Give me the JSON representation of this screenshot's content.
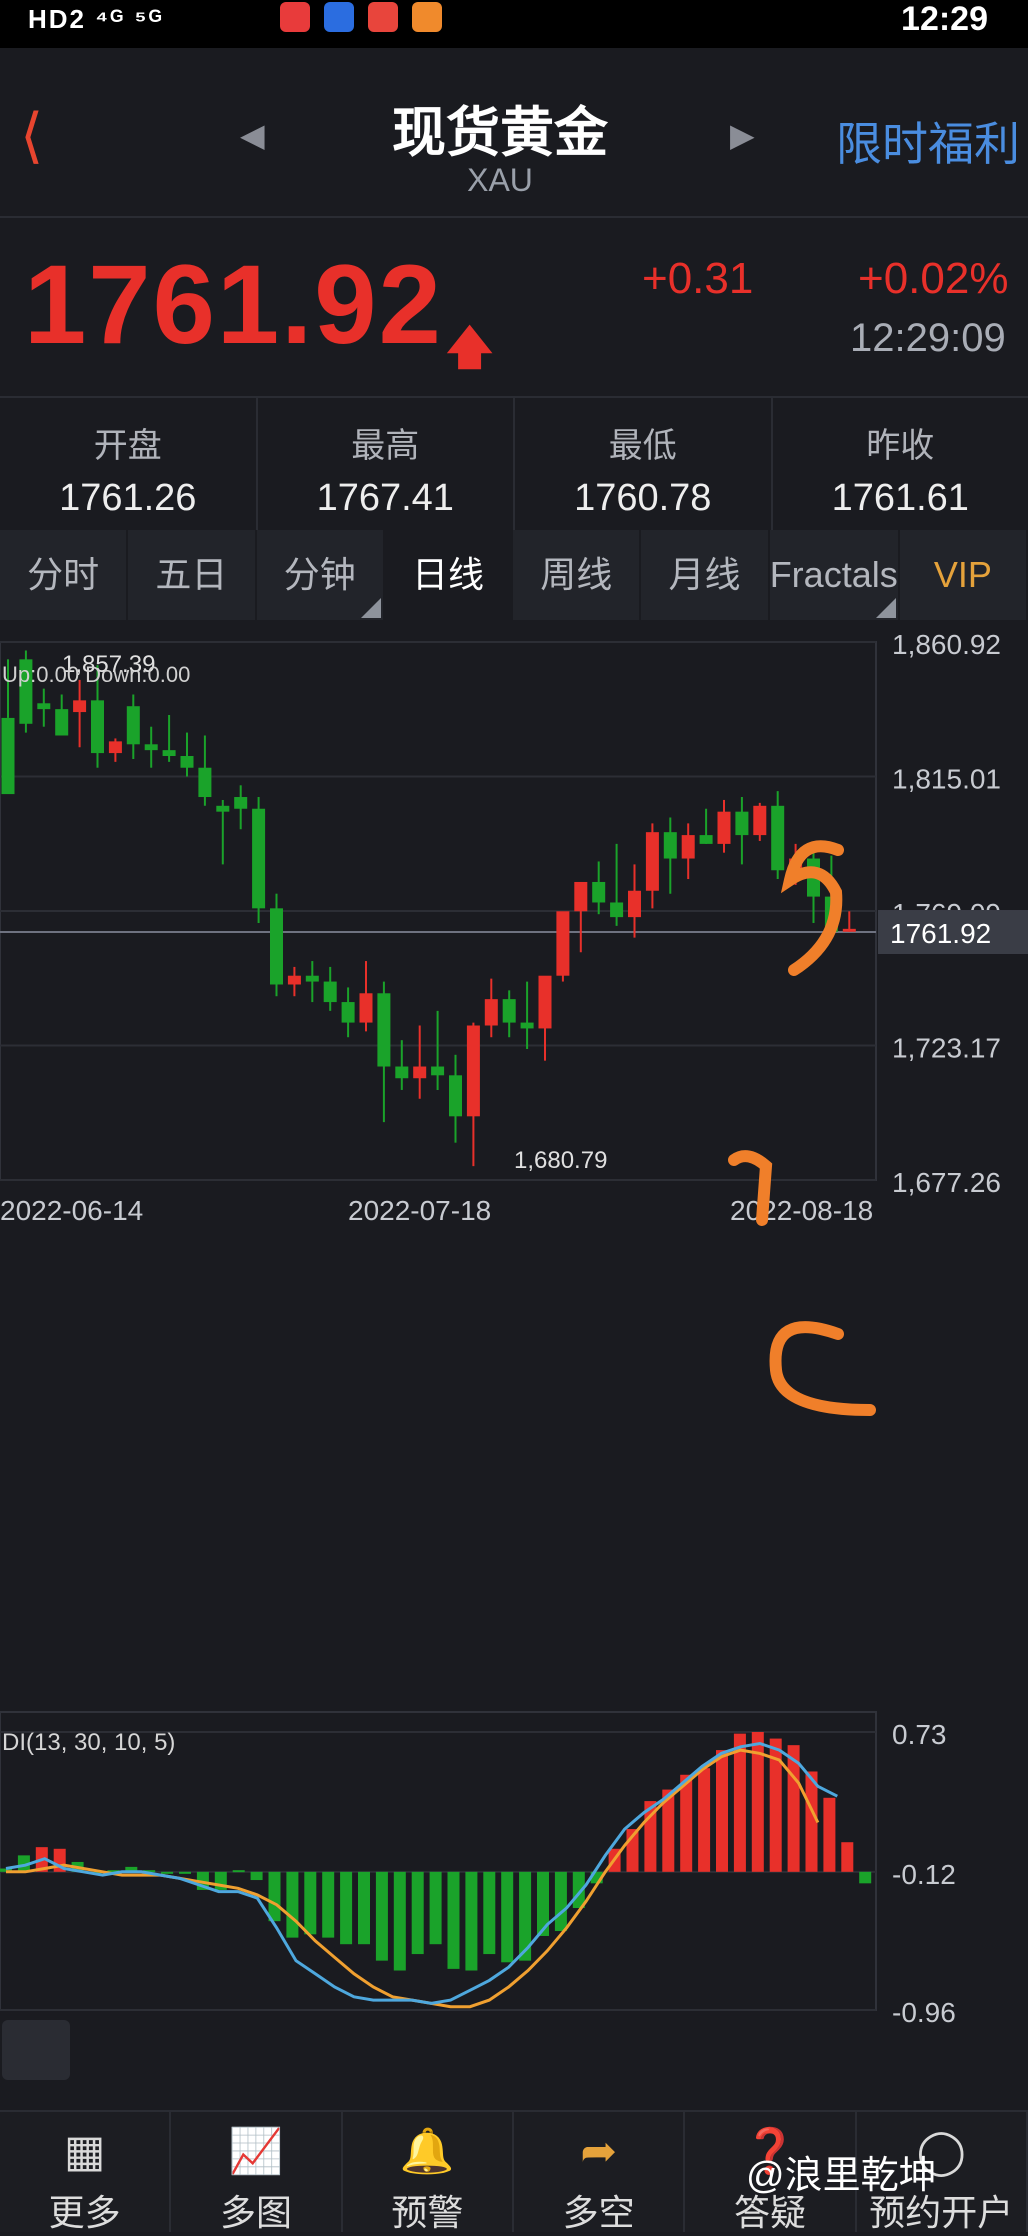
{
  "status_bar": {
    "left": "HD2 ⁴ᴳ ⁵ᴳ",
    "time": "12:29",
    "app_colors": [
      "#e83b3b",
      "#2b6de0",
      "#e8453c",
      "#f08a2c"
    ]
  },
  "header": {
    "title": "现货黄金",
    "subtitle": "XAU",
    "promo": "限时福利"
  },
  "quote": {
    "price": "1761.92",
    "change": "+0.31",
    "percent": "+0.02%",
    "time": "12:29:09"
  },
  "stats": [
    {
      "label": "开盘",
      "value": "1761.26"
    },
    {
      "label": "最高",
      "value": "1767.41"
    },
    {
      "label": "最低",
      "value": "1760.78"
    },
    {
      "label": "昨收",
      "value": "1761.61"
    }
  ],
  "tabs": [
    {
      "label": "分时",
      "corner": false
    },
    {
      "label": "五日",
      "corner": false
    },
    {
      "label": "分钟",
      "corner": true
    },
    {
      "label": "日线",
      "corner": false
    },
    {
      "label": "周线",
      "corner": false
    },
    {
      "label": "月线",
      "corner": false
    },
    {
      "label": "Fractals",
      "corner": true
    },
    {
      "label": "VIP",
      "corner": false
    }
  ],
  "chart_data": {
    "type": "candlestick",
    "y_axis": [
      "1,860.92",
      "1,815.01",
      "1,769.09",
      "1,723.17",
      "1,677.26"
    ],
    "ylim": [
      1677.26,
      1860.92
    ],
    "current_price": "1761.92",
    "x_axis": [
      "2022-06-14",
      "2022-07-18",
      "2022-08-18"
    ],
    "high_label": "1,857.39",
    "low_label": "1,680.79",
    "legend": "Up:0.00  Down:0.00",
    "colors": {
      "up": "#e8302a",
      "down": "#1aa32a"
    },
    "candles": [
      [
        1835,
        1855,
        1835,
        1809
      ],
      [
        1855,
        1858,
        1830,
        1833
      ],
      [
        1840,
        1845,
        1832,
        1838
      ],
      [
        1838,
        1843,
        1830,
        1829
      ],
      [
        1837,
        1848,
        1825,
        1841
      ],
      [
        1841,
        1853,
        1818,
        1823
      ],
      [
        1823,
        1828,
        1820,
        1827
      ],
      [
        1839,
        1843,
        1821,
        1826
      ],
      [
        1826,
        1832,
        1818,
        1824
      ],
      [
        1824,
        1836,
        1820,
        1822
      ],
      [
        1822,
        1830,
        1815,
        1818
      ],
      [
        1818,
        1829,
        1805,
        1808
      ],
      [
        1805,
        1807,
        1785,
        1803
      ],
      [
        1808,
        1812,
        1797,
        1804
      ],
      [
        1804,
        1808,
        1765,
        1770
      ],
      [
        1770,
        1775,
        1740,
        1744
      ],
      [
        1744,
        1750,
        1740,
        1747
      ],
      [
        1747,
        1752,
        1738,
        1745
      ],
      [
        1745,
        1750,
        1735,
        1738
      ],
      [
        1738,
        1743,
        1726,
        1731
      ],
      [
        1731,
        1752,
        1728,
        1741
      ],
      [
        1741,
        1745,
        1697,
        1716
      ],
      [
        1716,
        1725,
        1708,
        1712
      ],
      [
        1712,
        1730,
        1705,
        1716
      ],
      [
        1716,
        1735,
        1708,
        1713
      ],
      [
        1713,
        1720,
        1690,
        1699
      ],
      [
        1699,
        1731,
        1682,
        1730
      ],
      [
        1730,
        1746,
        1726,
        1739
      ],
      [
        1739,
        1742,
        1726,
        1731
      ],
      [
        1731,
        1745,
        1722,
        1729
      ],
      [
        1729,
        1743,
        1718,
        1747
      ],
      [
        1747,
        1766,
        1745,
        1769
      ],
      [
        1769,
        1779,
        1755,
        1779
      ],
      [
        1779,
        1786,
        1768,
        1772
      ],
      [
        1772,
        1792,
        1764,
        1767
      ],
      [
        1767,
        1785,
        1760,
        1776
      ],
      [
        1776,
        1799,
        1770,
        1796
      ],
      [
        1796,
        1801,
        1775,
        1787
      ],
      [
        1787,
        1799,
        1780,
        1795
      ],
      [
        1795,
        1804,
        1792,
        1792
      ],
      [
        1792,
        1807,
        1789,
        1803
      ],
      [
        1803,
        1808,
        1785,
        1795
      ],
      [
        1795,
        1806,
        1793,
        1805
      ],
      [
        1805,
        1810,
        1780,
        1783
      ],
      [
        1783,
        1792,
        1778,
        1787
      ],
      [
        1787,
        1789,
        1765,
        1774
      ],
      [
        1774,
        1788,
        1762,
        1762
      ],
      [
        1762,
        1769,
        1762,
        1763
      ]
    ],
    "indicator": {
      "label": "DI(13, 30, 10, 5)",
      "y_axis": [
        "0.73",
        "-0.12",
        "-0.96"
      ],
      "ylim": [
        -0.96,
        0.73
      ],
      "histogram": [
        -0.1,
        -0.02,
        0.03,
        0.02,
        -0.06,
        -0.12,
        -0.11,
        -0.09,
        -0.11,
        -0.13,
        -0.13,
        -0.23,
        -0.23,
        -0.11,
        -0.17,
        -0.42,
        -0.52,
        -0.5,
        -0.52,
        -0.56,
        -0.56,
        -0.66,
        -0.72,
        -0.62,
        -0.56,
        -0.71,
        -0.72,
        -0.62,
        -0.67,
        -0.66,
        -0.51,
        -0.48,
        -0.34,
        -0.19,
        0.02,
        0.14,
        0.31,
        0.38,
        0.47,
        0.51,
        0.62,
        0.72,
        0.73,
        0.69,
        0.65,
        0.49,
        0.33,
        0.06,
        -0.19
      ],
      "line_fast": [
        -0.1,
        -0.08,
        -0.04,
        -0.1,
        -0.12,
        -0.14,
        -0.12,
        -0.12,
        -0.14,
        -0.16,
        -0.2,
        -0.24,
        -0.24,
        -0.28,
        -0.46,
        -0.66,
        -0.74,
        -0.82,
        -0.88,
        -0.9,
        -0.9,
        -0.9,
        -0.92,
        -0.9,
        -0.84,
        -0.78,
        -0.7,
        -0.58,
        -0.44,
        -0.34,
        -0.2,
        -0.02,
        0.14,
        0.24,
        0.32,
        0.42,
        0.52,
        0.6,
        0.64,
        0.66,
        0.62,
        0.54,
        0.4,
        0.34
      ],
      "line_slow": [
        -0.12,
        -0.12,
        -0.1,
        -0.08,
        -0.1,
        -0.12,
        -0.14,
        -0.14,
        -0.14,
        -0.16,
        -0.18,
        -0.2,
        -0.22,
        -0.26,
        -0.32,
        -0.42,
        -0.54,
        -0.64,
        -0.74,
        -0.82,
        -0.88,
        -0.9,
        -0.92,
        -0.94,
        -0.94,
        -0.9,
        -0.82,
        -0.72,
        -0.6,
        -0.46,
        -0.3,
        -0.12,
        0.04,
        0.18,
        0.3,
        0.4,
        0.5,
        0.58,
        0.62,
        0.6,
        0.56,
        0.42,
        0.18
      ],
      "colors": {
        "fast": "#4ea8de",
        "slow": "#f0a030",
        "up": "#e8302a",
        "down": "#1aa32a"
      }
    },
    "annotations": [
      "5",
      "4",
      "C"
    ],
    "annotation_color": "#f07f2a"
  },
  "bottom_nav": [
    {
      "label": "更多",
      "icon": "grid-icon"
    },
    {
      "label": "多图",
      "icon": "chart-icon"
    },
    {
      "label": "预警",
      "icon": "bell-icon"
    },
    {
      "label": "多空",
      "icon": "trend-icon"
    },
    {
      "label": "答疑",
      "icon": "question-icon"
    },
    {
      "label": "预约开户",
      "icon": "account-icon"
    }
  ],
  "watermark": "@浪里乾坤"
}
